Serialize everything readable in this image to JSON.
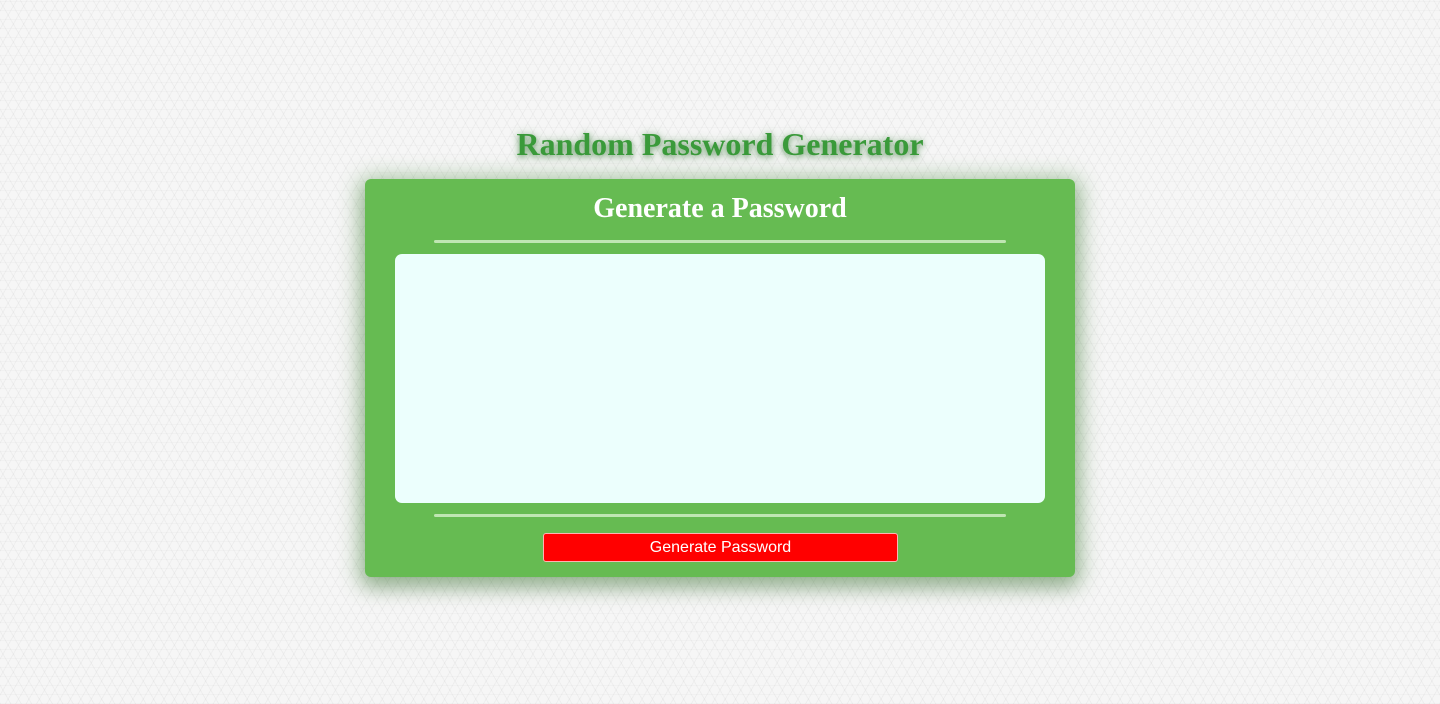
{
  "page": {
    "title": "Random Password Generator"
  },
  "card": {
    "title": "Generate a Password",
    "password": {
      "value": "",
      "placeholder": ""
    },
    "generate_button_label": "Generate Password"
  },
  "colors": {
    "title_green": "#3a9a3a",
    "card_green": "#66bb52",
    "textarea_bg": "#ecfffd",
    "button_red": "#ff0000",
    "divider": "#bfe6b3"
  }
}
